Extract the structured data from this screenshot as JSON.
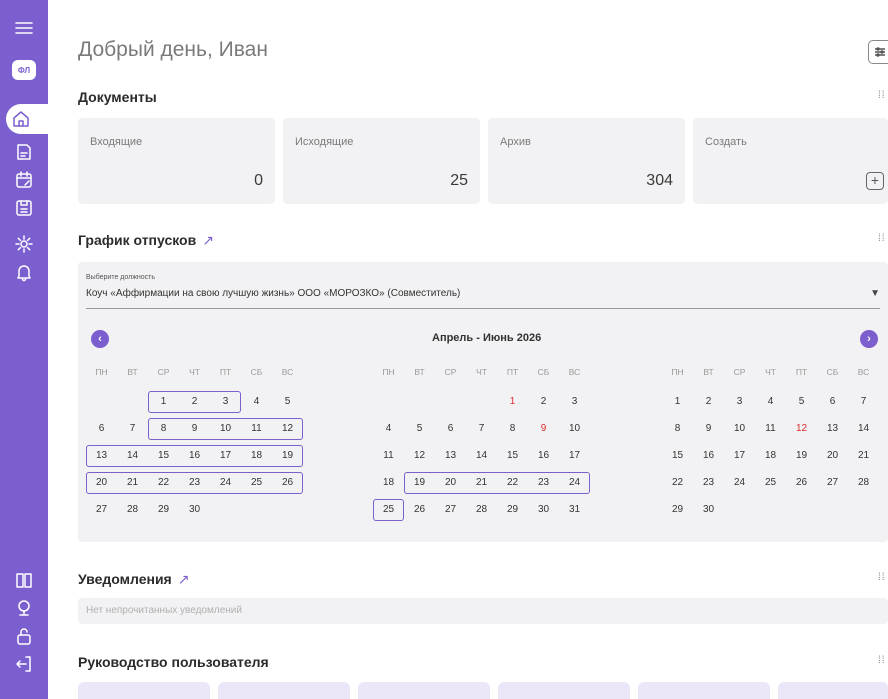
{
  "avatar": {
    "initials": "ФЛ"
  },
  "greeting": "Добрый день, Иван",
  "documents": {
    "title": "Документы",
    "cards": [
      {
        "label": "Входящие",
        "value": "0"
      },
      {
        "label": "Исходящие",
        "value": "25"
      },
      {
        "label": "Архив",
        "value": "304"
      },
      {
        "label": "Создать",
        "value": ""
      }
    ],
    "create_symbol": "+"
  },
  "vacation": {
    "title": "График отпусков",
    "link_arrow": "↗",
    "select_label": "Выберите должность",
    "select_value": "Коуч «Аффирмации на свою лучшую жизнь» ООО «МОРОЗКО» (Совместитель)",
    "period": "Апрель - Июнь 2026",
    "weekdays": [
      "ПН",
      "ВТ",
      "СР",
      "ЧТ",
      "ПТ",
      "СБ",
      "ВС"
    ],
    "months": [
      {
        "offset": 2,
        "days": 30,
        "red": []
      },
      {
        "offset": 4,
        "days": 31,
        "red": [
          1,
          9
        ]
      },
      {
        "offset": 0,
        "days": 30,
        "red": [
          12
        ]
      }
    ],
    "ranges": [
      {
        "month": 0,
        "from": 1,
        "to": 3
      },
      {
        "month": 0,
        "from": 8,
        "to": 12
      },
      {
        "month": 0,
        "from": 13,
        "to": 19
      },
      {
        "month": 0,
        "from": 20,
        "to": 26
      },
      {
        "month": 1,
        "from": 19,
        "to": 24
      },
      {
        "month": 1,
        "from": 25,
        "to": 25
      }
    ]
  },
  "notifications": {
    "title": "Уведомления",
    "link_arrow": "↗",
    "empty_text": "Нет непрочитанных уведомлений"
  },
  "guide": {
    "title": "Руководство пользователя"
  },
  "colors": {
    "accent": "#7b5fcf",
    "holiday": "#e02b2b",
    "panel": "#f2f2f4"
  }
}
